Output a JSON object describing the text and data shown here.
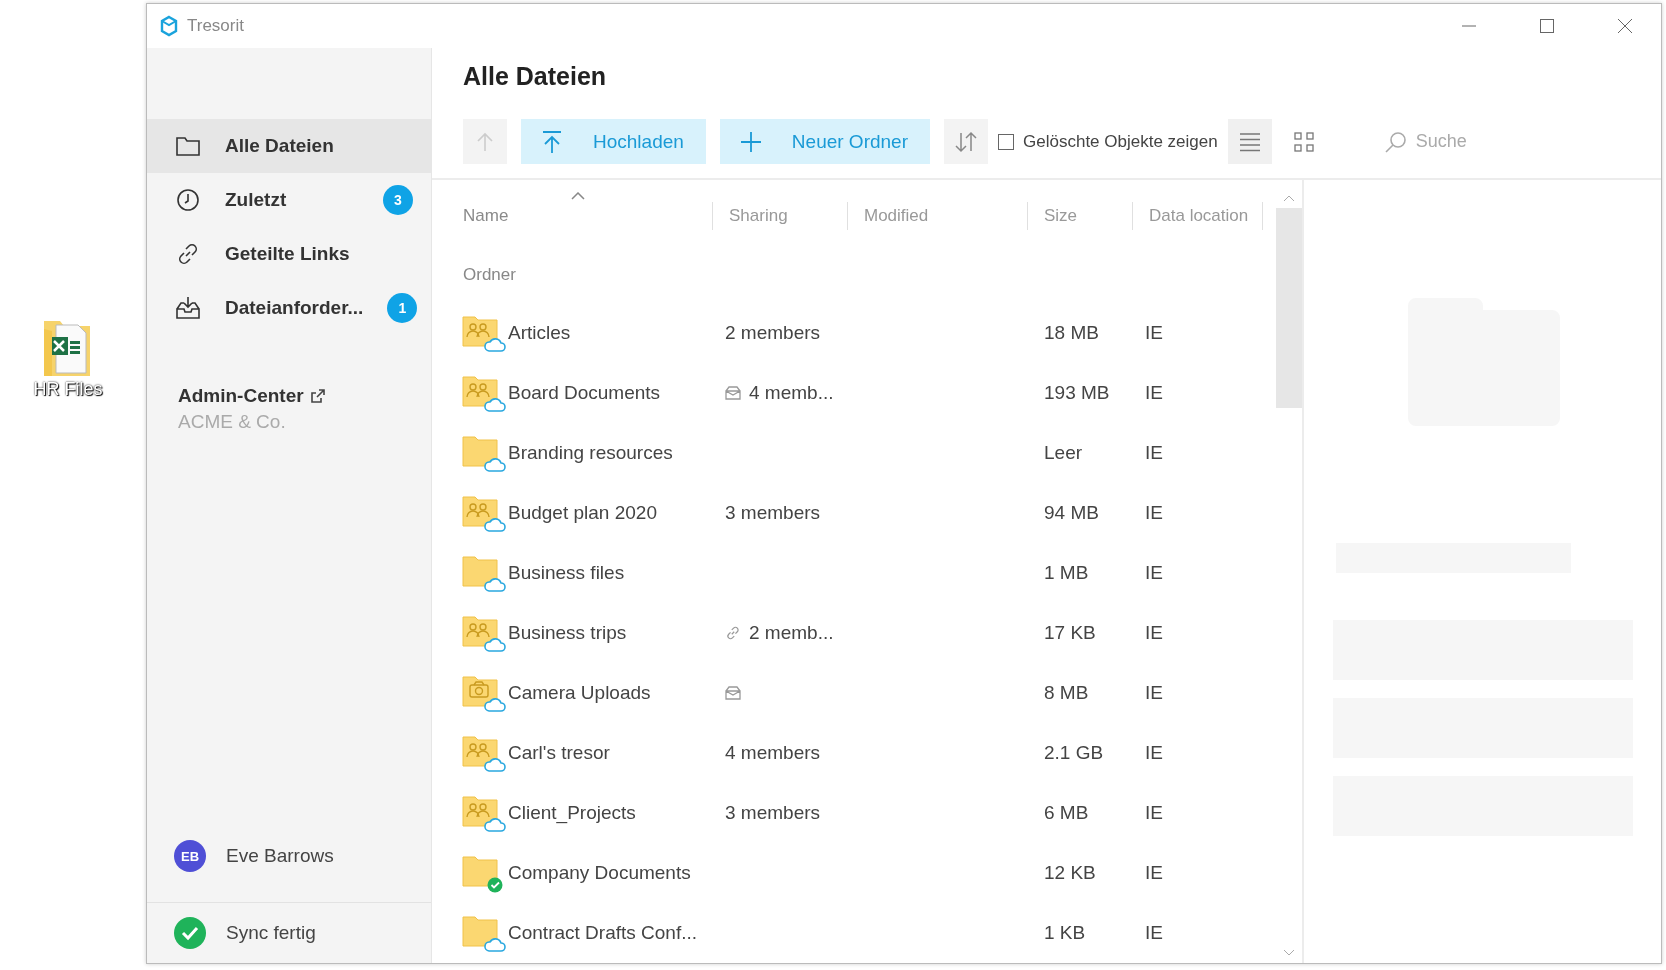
{
  "desktop_icons": [
    {
      "label": "HR Files"
    }
  ],
  "window": {
    "title": "Tresorit"
  },
  "sidebar": {
    "items": [
      {
        "label": "Alle Dateien",
        "selected": true
      },
      {
        "label": "Zuletzt",
        "selected": false,
        "badge": "3"
      },
      {
        "label": "Geteilte Links",
        "selected": false
      },
      {
        "label": "Dateianforder...",
        "selected": false,
        "badge": "1"
      }
    ],
    "admin": {
      "link": "Admin-Center",
      "company": "ACME & Co."
    },
    "user": {
      "initials": "EB",
      "name": "Eve Barrows"
    },
    "sync_status": {
      "label": "Sync fertig"
    }
  },
  "main": {
    "title": "Alle Dateien",
    "toolbar": {
      "upload": "Hochladen",
      "new_folder": "Neuer Ordner",
      "show_deleted": {
        "label": "Gelöschte Objekte zeigen",
        "checked": false
      },
      "views": [
        {
          "kind": "list",
          "selected": true
        },
        {
          "kind": "grid",
          "selected": false
        }
      ],
      "search": {
        "placeholder": "Suche"
      }
    },
    "table": {
      "columns": [
        {
          "label": "Name",
          "sorted": true
        },
        {
          "label": "Sharing",
          "sorted": false
        },
        {
          "label": "Modified",
          "sorted": false
        },
        {
          "label": "Size",
          "sorted": false
        },
        {
          "label": "Data location",
          "sorted": false
        }
      ],
      "group": "Ordner",
      "rows": [
        {
          "name": "Articles",
          "kind": "shared",
          "synced": false,
          "invited": false,
          "link_shared": false,
          "sharing": "2 members",
          "size": "18 MB",
          "location": "IE"
        },
        {
          "name": "Board Documents",
          "kind": "shared",
          "synced": false,
          "invited": true,
          "link_shared": false,
          "sharing": "4 memb...",
          "size": "193 MB",
          "location": "IE"
        },
        {
          "name": "Branding resources",
          "kind": "plain",
          "synced": false,
          "invited": false,
          "link_shared": false,
          "size": "Leer",
          "location": "IE"
        },
        {
          "name": "Budget plan 2020",
          "kind": "shared",
          "synced": false,
          "invited": false,
          "link_shared": false,
          "sharing": "3 members",
          "size": "94 MB",
          "location": "IE"
        },
        {
          "name": "Business files",
          "kind": "plain",
          "synced": false,
          "invited": false,
          "link_shared": false,
          "size": "1 MB",
          "location": "IE"
        },
        {
          "name": "Business trips",
          "kind": "shared",
          "synced": false,
          "invited": false,
          "link_shared": true,
          "sharing": "2 memb...",
          "size": "17 KB",
          "location": "IE"
        },
        {
          "name": "Camera Uploads",
          "kind": "camera",
          "synced": false,
          "invited": true,
          "link_shared": false,
          "size": "8 MB",
          "location": "IE"
        },
        {
          "name": "Carl's tresor",
          "kind": "shared",
          "synced": false,
          "invited": false,
          "link_shared": false,
          "sharing": "4 members",
          "size": "2.1 GB",
          "location": "IE"
        },
        {
          "name": "Client_Projects",
          "kind": "shared",
          "synced": false,
          "invited": false,
          "link_shared": false,
          "sharing": "3 members",
          "size": "6 MB",
          "location": "IE"
        },
        {
          "name": "Company Documents",
          "kind": "plain",
          "synced": true,
          "invited": false,
          "link_shared": false,
          "size": "12 KB",
          "location": "IE"
        },
        {
          "name": "Contract Drafts Conf...",
          "kind": "plain",
          "synced": false,
          "invited": false,
          "link_shared": false,
          "size": "1 KB",
          "location": "IE"
        }
      ]
    }
  }
}
